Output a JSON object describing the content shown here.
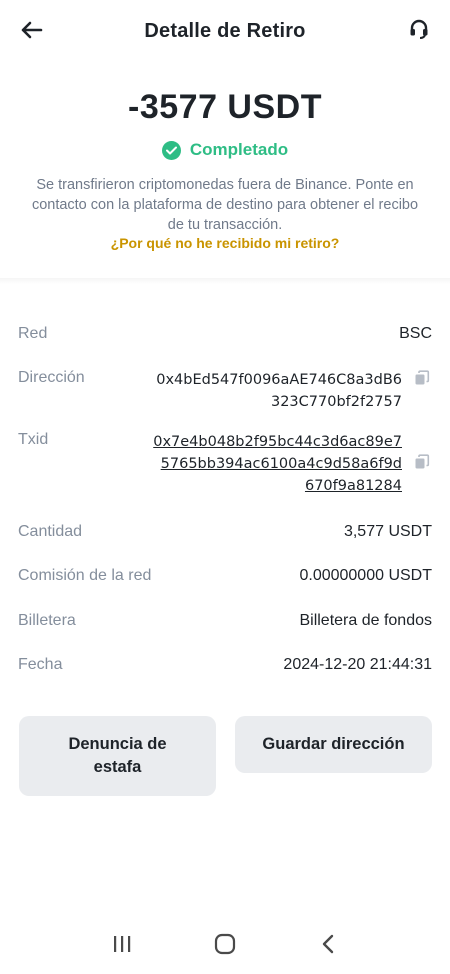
{
  "header": {
    "title": "Detalle de Retiro",
    "back_icon": "arrow-left-icon",
    "support_icon": "headset-icon"
  },
  "summary": {
    "amount": "-3577 USDT",
    "status": "Completado",
    "status_color": "#2ebd85",
    "description": "Se transfirieron criptomonedas fuera de Binance. Ponte en contacto con la plataforma de destino para obtener el recibo de tu transacción.",
    "help_link": "¿Por qué no he recibido mi retiro?",
    "help_color": "#c99400"
  },
  "details": {
    "network": {
      "label": "Red",
      "value": "BSC"
    },
    "address": {
      "label": "Dirección",
      "value": "0x4bEd547f0096aAE746C8a3dB6323C770bf2f2757"
    },
    "txid": {
      "label": "Txid",
      "value": "0x7e4b048b2f95bc44c3d6ac89e75765bb394ac6100a4c9d58a6f9d670f9a81284"
    },
    "amount": {
      "label": "Cantidad",
      "value": "3,577 USDT"
    },
    "fee": {
      "label": "Comisión de la red",
      "value": "0.00000000 USDT"
    },
    "wallet": {
      "label": "Billetera",
      "value": "Billetera de fondos"
    },
    "date": {
      "label": "Fecha",
      "value": "2024-12-20 21:44:31"
    }
  },
  "actions": {
    "report_scam": "Denuncia de estafa",
    "save_address": "Guardar dirección"
  },
  "navbar": {
    "recent_icon": "recent-apps-icon",
    "home_icon": "home-icon",
    "back_icon": "back-chevron-icon"
  }
}
